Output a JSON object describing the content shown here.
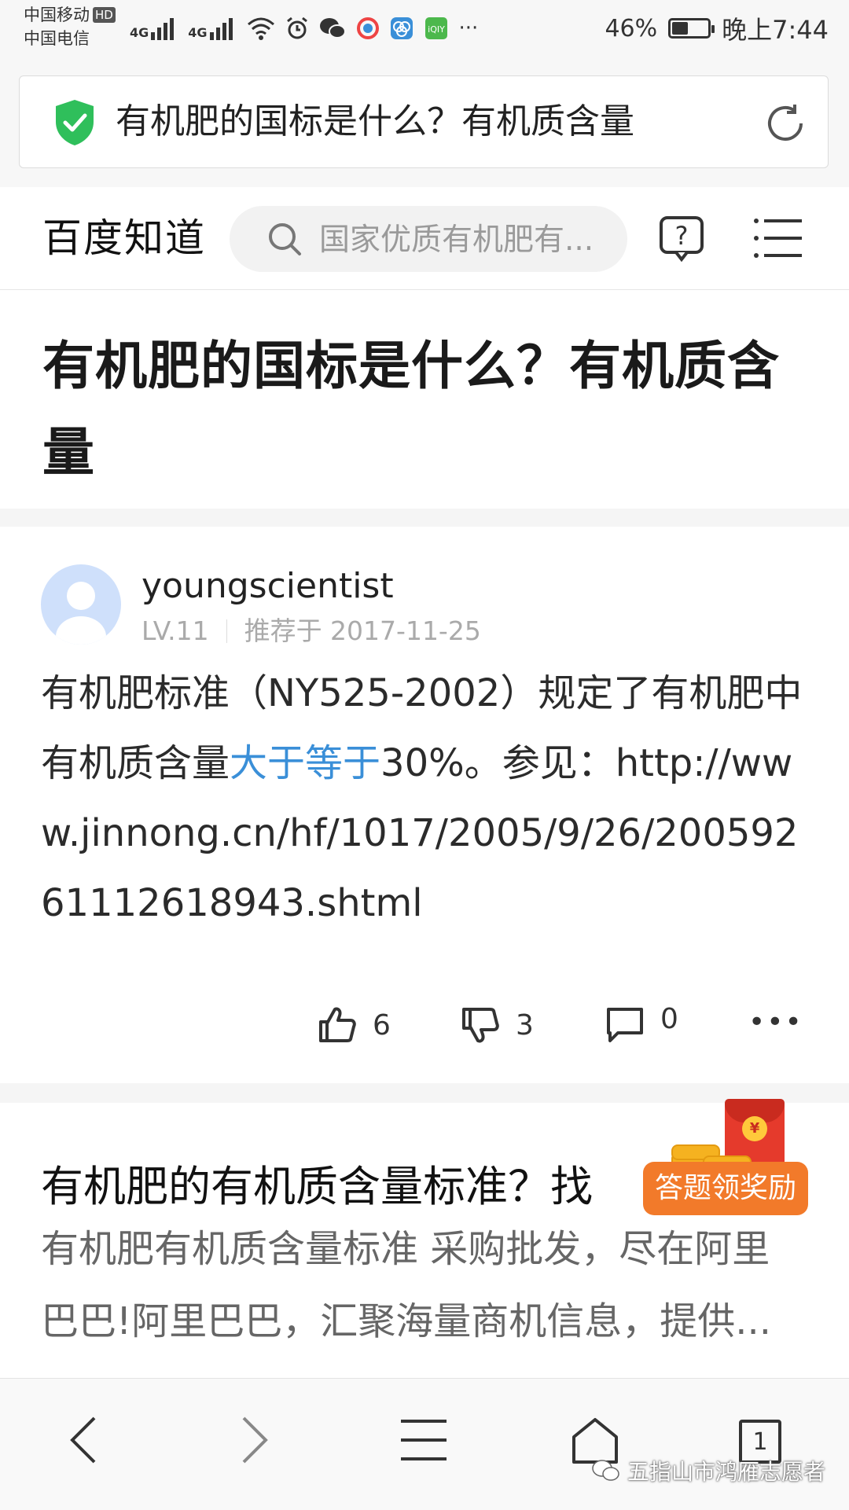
{
  "status_bar": {
    "carrier1": "中国移动",
    "hd": "HD",
    "carrier2": "中国电信",
    "signal1": "4G",
    "signal2": "4G",
    "more": "···",
    "battery_percent": "46%",
    "battery_level": 0.46,
    "time": "晚上7:44",
    "icons": [
      "signal-icon",
      "wifi-icon",
      "alarm-icon",
      "wechat-icon",
      "app-icon",
      "app-icon",
      "iqiyi-icon"
    ]
  },
  "browser": {
    "url_title": "有机肥的国标是什么？有机质含量"
  },
  "header": {
    "logo": "百度知道",
    "search_placeholder": "国家优质有机肥有..."
  },
  "question": {
    "title": "有机肥的国标是什么？有机质含量"
  },
  "answer": {
    "username": "youngscientist",
    "level": "LV.11",
    "recommended": "推荐于 2017-11-25",
    "body_part1": "有机肥标准（NY525-2002）规定了有机肥中有机质含量",
    "body_link": "大于等于",
    "body_part2": "30%。参见：http://www.jinnong.cn/hf/1017/2005/9/26/20059261112618943.shtml",
    "likes": "6",
    "dislikes": "3",
    "comments": "0",
    "more": "•••"
  },
  "related": {
    "title": "有机肥的有机质含量标准？找",
    "desc": "有机肥有机质含量标准 采购批发，尽在阿里巴巴!阿里巴巴，汇聚海量商机信息，提供..."
  },
  "reward": {
    "label": "答题领奖励",
    "coin_symbol": "¥"
  },
  "bottom_nav": {
    "tab_count": "1"
  },
  "watermark": "五指山市鸿雁志愿者"
}
